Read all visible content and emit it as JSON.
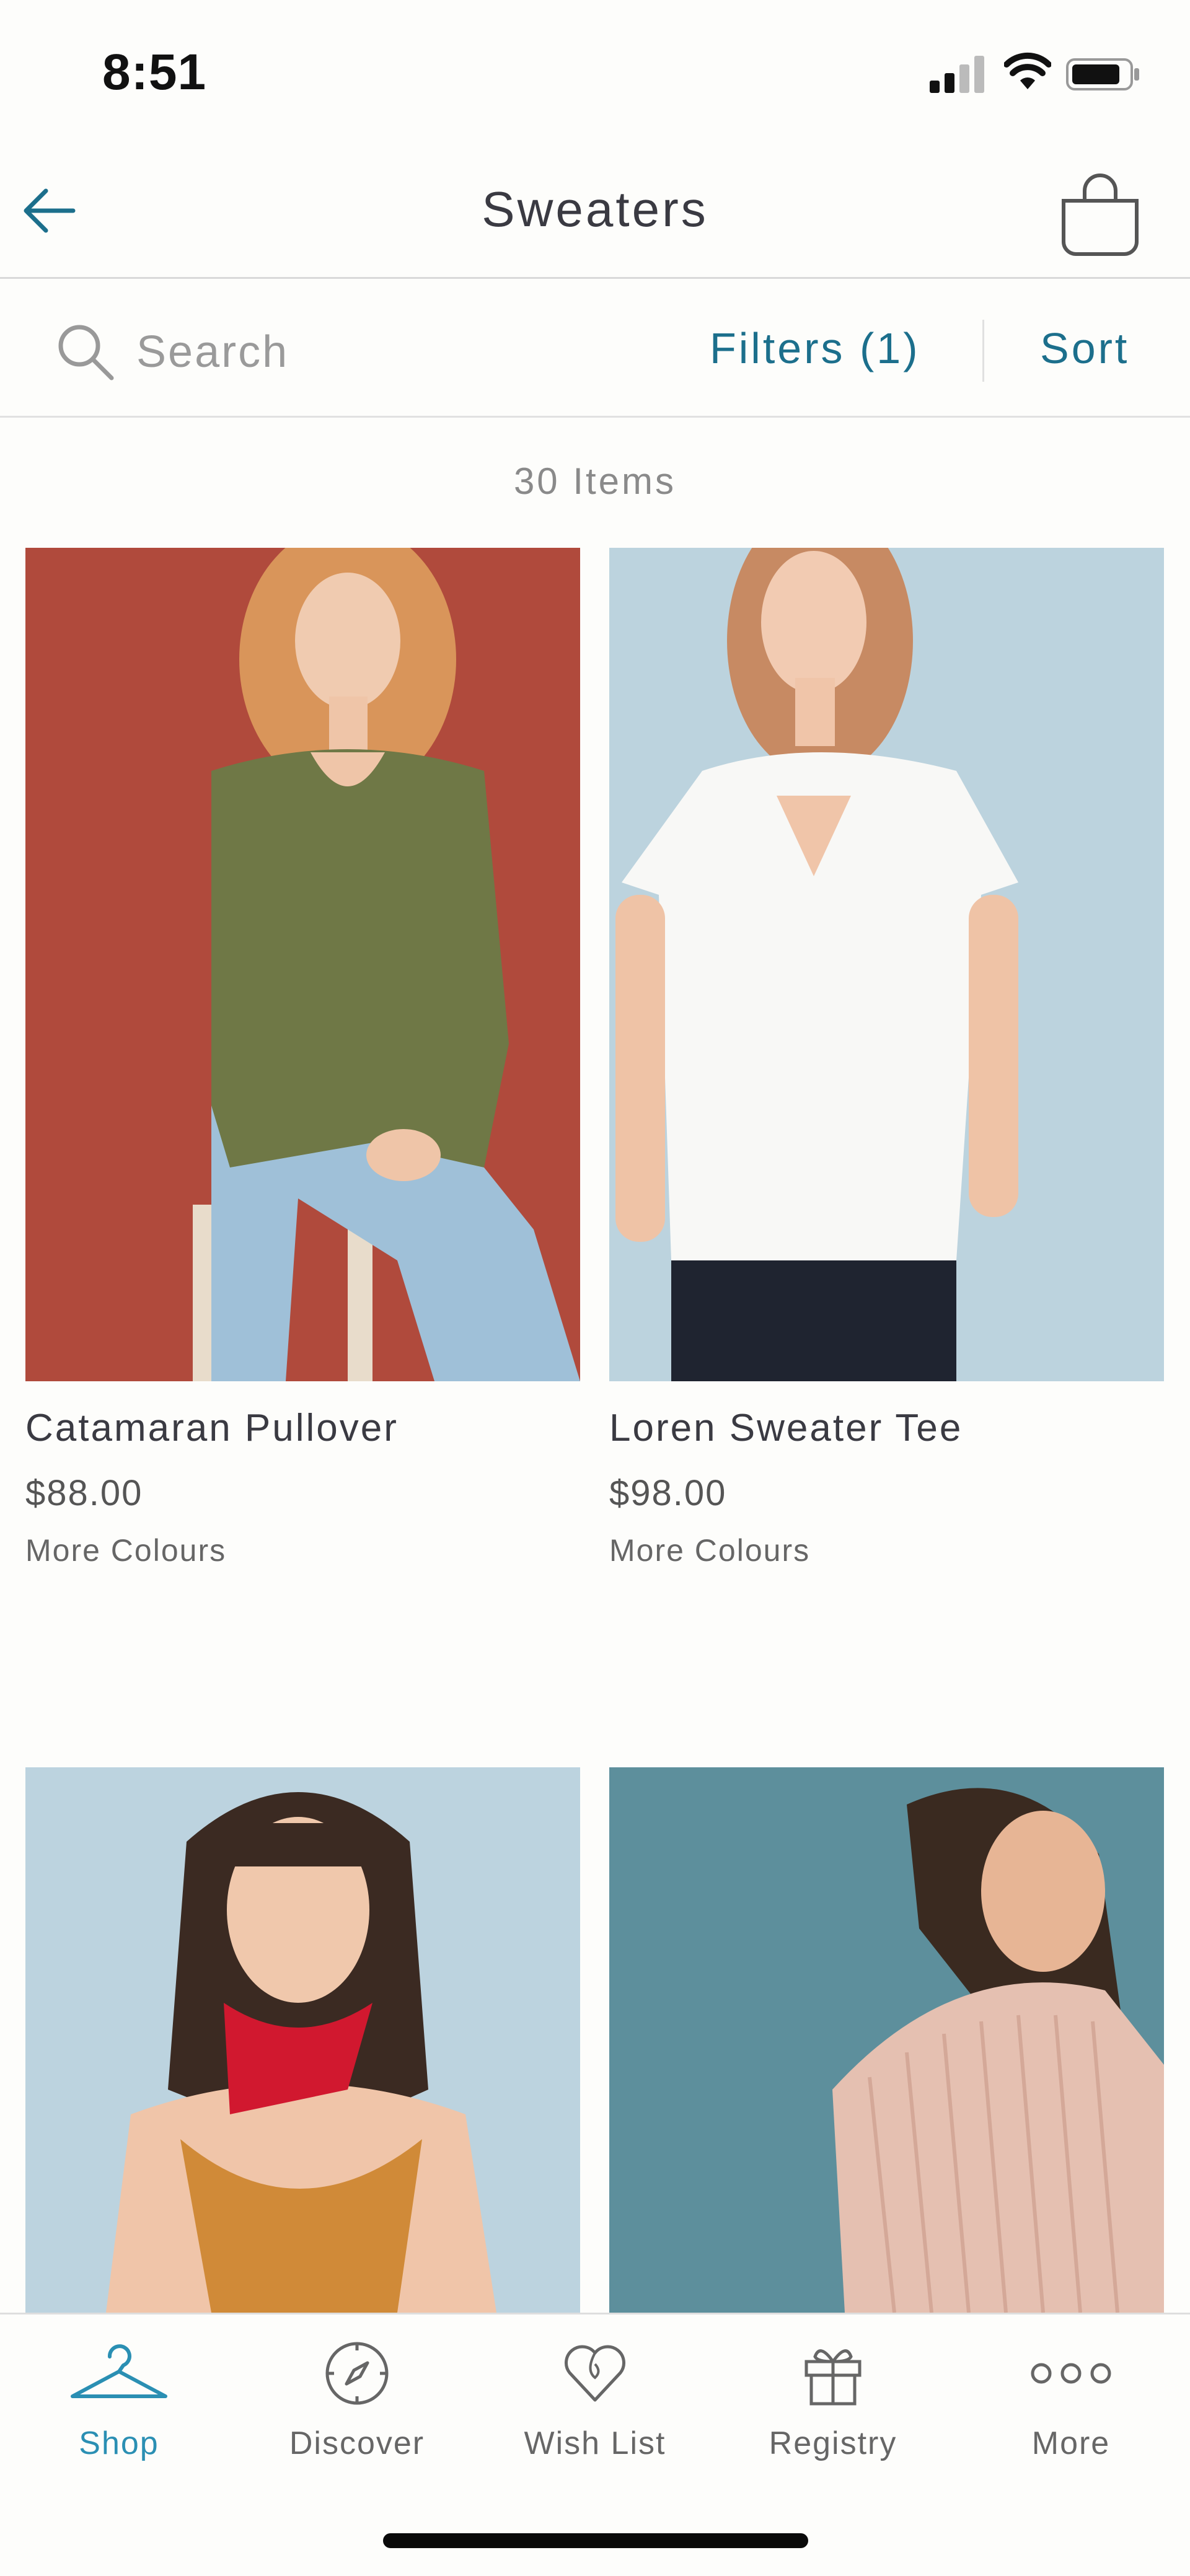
{
  "status_bar": {
    "time": "8:51"
  },
  "header": {
    "title": "Sweaters",
    "back_icon": "arrow-left-icon",
    "bag_icon": "shopping-bag-icon"
  },
  "toolbar": {
    "search_placeholder": "Search",
    "filters_label": "Filters (1)",
    "sort_label": "Sort"
  },
  "listing": {
    "item_count": "30 Items",
    "products": [
      {
        "name": "Catamaran Pullover",
        "price": "$88.00",
        "colours": "More Colours"
      },
      {
        "name": "Loren Sweater Tee",
        "price": "$98.00",
        "colours": "More Colours"
      },
      {
        "name": "",
        "price": "",
        "colours": ""
      },
      {
        "name": "",
        "price": "",
        "colours": ""
      }
    ]
  },
  "tab_bar": {
    "tabs": [
      {
        "label": "Shop",
        "icon": "hanger-icon",
        "active": true
      },
      {
        "label": "Discover",
        "icon": "compass-icon",
        "active": false
      },
      {
        "label": "Wish List",
        "icon": "heart-icon",
        "active": false
      },
      {
        "label": "Registry",
        "icon": "gift-icon",
        "active": false
      },
      {
        "label": "More",
        "icon": "more-dots-icon",
        "active": false
      }
    ]
  },
  "colors": {
    "accent": "#1c6f8c",
    "active_tab": "#2a8fb3",
    "background": "#fdfdfb"
  }
}
